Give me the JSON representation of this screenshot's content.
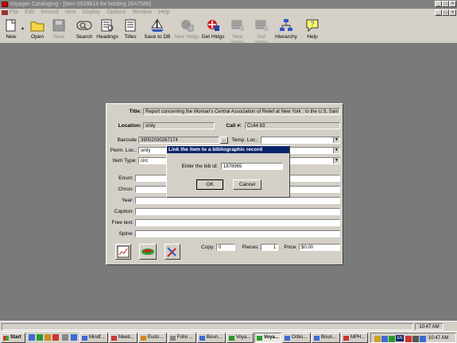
{
  "window": {
    "title": "Voyager Cataloging - [Item 5539814 for holding 2047586]"
  },
  "menu": [
    "File",
    "Edit",
    "Record",
    "Item",
    "Display",
    "Options",
    "Window",
    "Help"
  ],
  "toolbar": [
    {
      "label": "New",
      "icon": "new-icon",
      "enabled": true
    },
    {
      "label": "Open",
      "icon": "folder-icon",
      "enabled": true
    },
    {
      "label": "Save",
      "icon": "save-icon",
      "enabled": false
    },
    {
      "label": "Search",
      "icon": "search-icon",
      "enabled": true
    },
    {
      "label": "Headings",
      "icon": "headings-icon",
      "enabled": true
    },
    {
      "label": "Titles",
      "icon": "titles-icon",
      "enabled": true
    },
    {
      "label": "Save to DB",
      "icon": "sailboat-icon",
      "enabled": true
    },
    {
      "label": "New Hldgs",
      "icon": "new-holdings-icon",
      "enabled": false
    },
    {
      "label": "Get Hldgs",
      "icon": "get-holdings-icon",
      "enabled": true
    },
    {
      "label": "New Items",
      "icon": "new-items-icon",
      "enabled": false
    },
    {
      "label": "Get Items",
      "icon": "get-items-icon",
      "enabled": false
    },
    {
      "label": "Hierarchy",
      "icon": "hierarchy-icon",
      "enabled": true
    },
    {
      "label": "Help",
      "icon": "help-icon",
      "enabled": true
    }
  ],
  "form": {
    "title_label": "Title:",
    "title_value": "Report concerning the Woman's Central Association of Relief at New York : to the U.S. Sani",
    "location_label": "Location:",
    "location_value": "smly",
    "callno_label": "Call #:",
    "callno_value": "Cc44 83",
    "barcode_label": "Barcode",
    "barcode_value": "39002030267174",
    "barcode_btn": "...",
    "temp_loc_label": "Temp. Loc.:",
    "perm_loc_label": "Perm. Loc.:",
    "perm_loc_value": "smly",
    "item_type_label": "Item Type:",
    "item_type_value": "circ",
    "enum_label": "Enum:",
    "chron_label": "Chron:",
    "year_label": "Year:",
    "caption_label": "Caption:",
    "free_text_label": "Free text:",
    "spine_label": "Spine:",
    "copy_label": "Copy:",
    "copy_value": "0",
    "pieces_label": "Pieces:",
    "pieces_value": "1",
    "price_label": "Price:",
    "price_value": "$0.00"
  },
  "dialog": {
    "title": "Link the item to a bibliographic record",
    "prompt": "Enter the bib id:",
    "value": "1878965",
    "ok": "OK",
    "cancel": "Cancel"
  },
  "status": {
    "time": "10:47 AM"
  },
  "taskbar": {
    "start": "Start",
    "tasks": [
      "Mindf...",
      "Meeti...",
      "Eudo...",
      "Folio ...",
      "Boun...",
      "Voya...",
      "Voya...",
      "Orbis...",
      "Boun...",
      "MPH..."
    ],
    "lang": "EN",
    "clock": "10:47 AM"
  }
}
